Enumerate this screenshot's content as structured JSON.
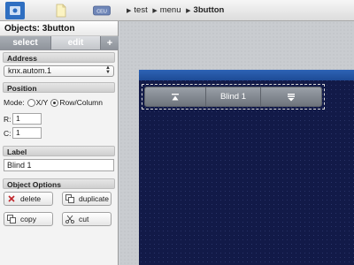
{
  "toolbar": {
    "icons": [
      "app-icon",
      "document-icon",
      "device-icon"
    ],
    "device_label": "CEU"
  },
  "breadcrumb": {
    "items": [
      "test",
      "menu"
    ],
    "current": "3button"
  },
  "panel": {
    "title": "Objects: 3button",
    "tabs": {
      "select": "select",
      "edit": "edit",
      "add": "+"
    },
    "address": {
      "heading": "Address",
      "value": "knx.autom.1"
    },
    "position": {
      "heading": "Position",
      "mode_label": "Mode:",
      "options": [
        "X/Y",
        "Row/Column"
      ],
      "selected": "Row/Column",
      "row_label": "R:",
      "row_value": "1",
      "col_label": "C:",
      "col_value": "1"
    },
    "label": {
      "heading": "Label",
      "value": "Blind 1"
    },
    "object_options": {
      "heading": "Object Options",
      "buttons": {
        "delete": "delete",
        "duplicate": "duplicate",
        "copy": "copy",
        "cut": "cut"
      }
    }
  },
  "canvas": {
    "widget": {
      "label": "Blind 1",
      "left_icon": "move-up-icon",
      "right_icon": "move-down-icon"
    }
  },
  "colors": {
    "screen_background": "#121a48",
    "screen_header": "#2e63b5",
    "toolbar_active": "#2f6fc1"
  }
}
